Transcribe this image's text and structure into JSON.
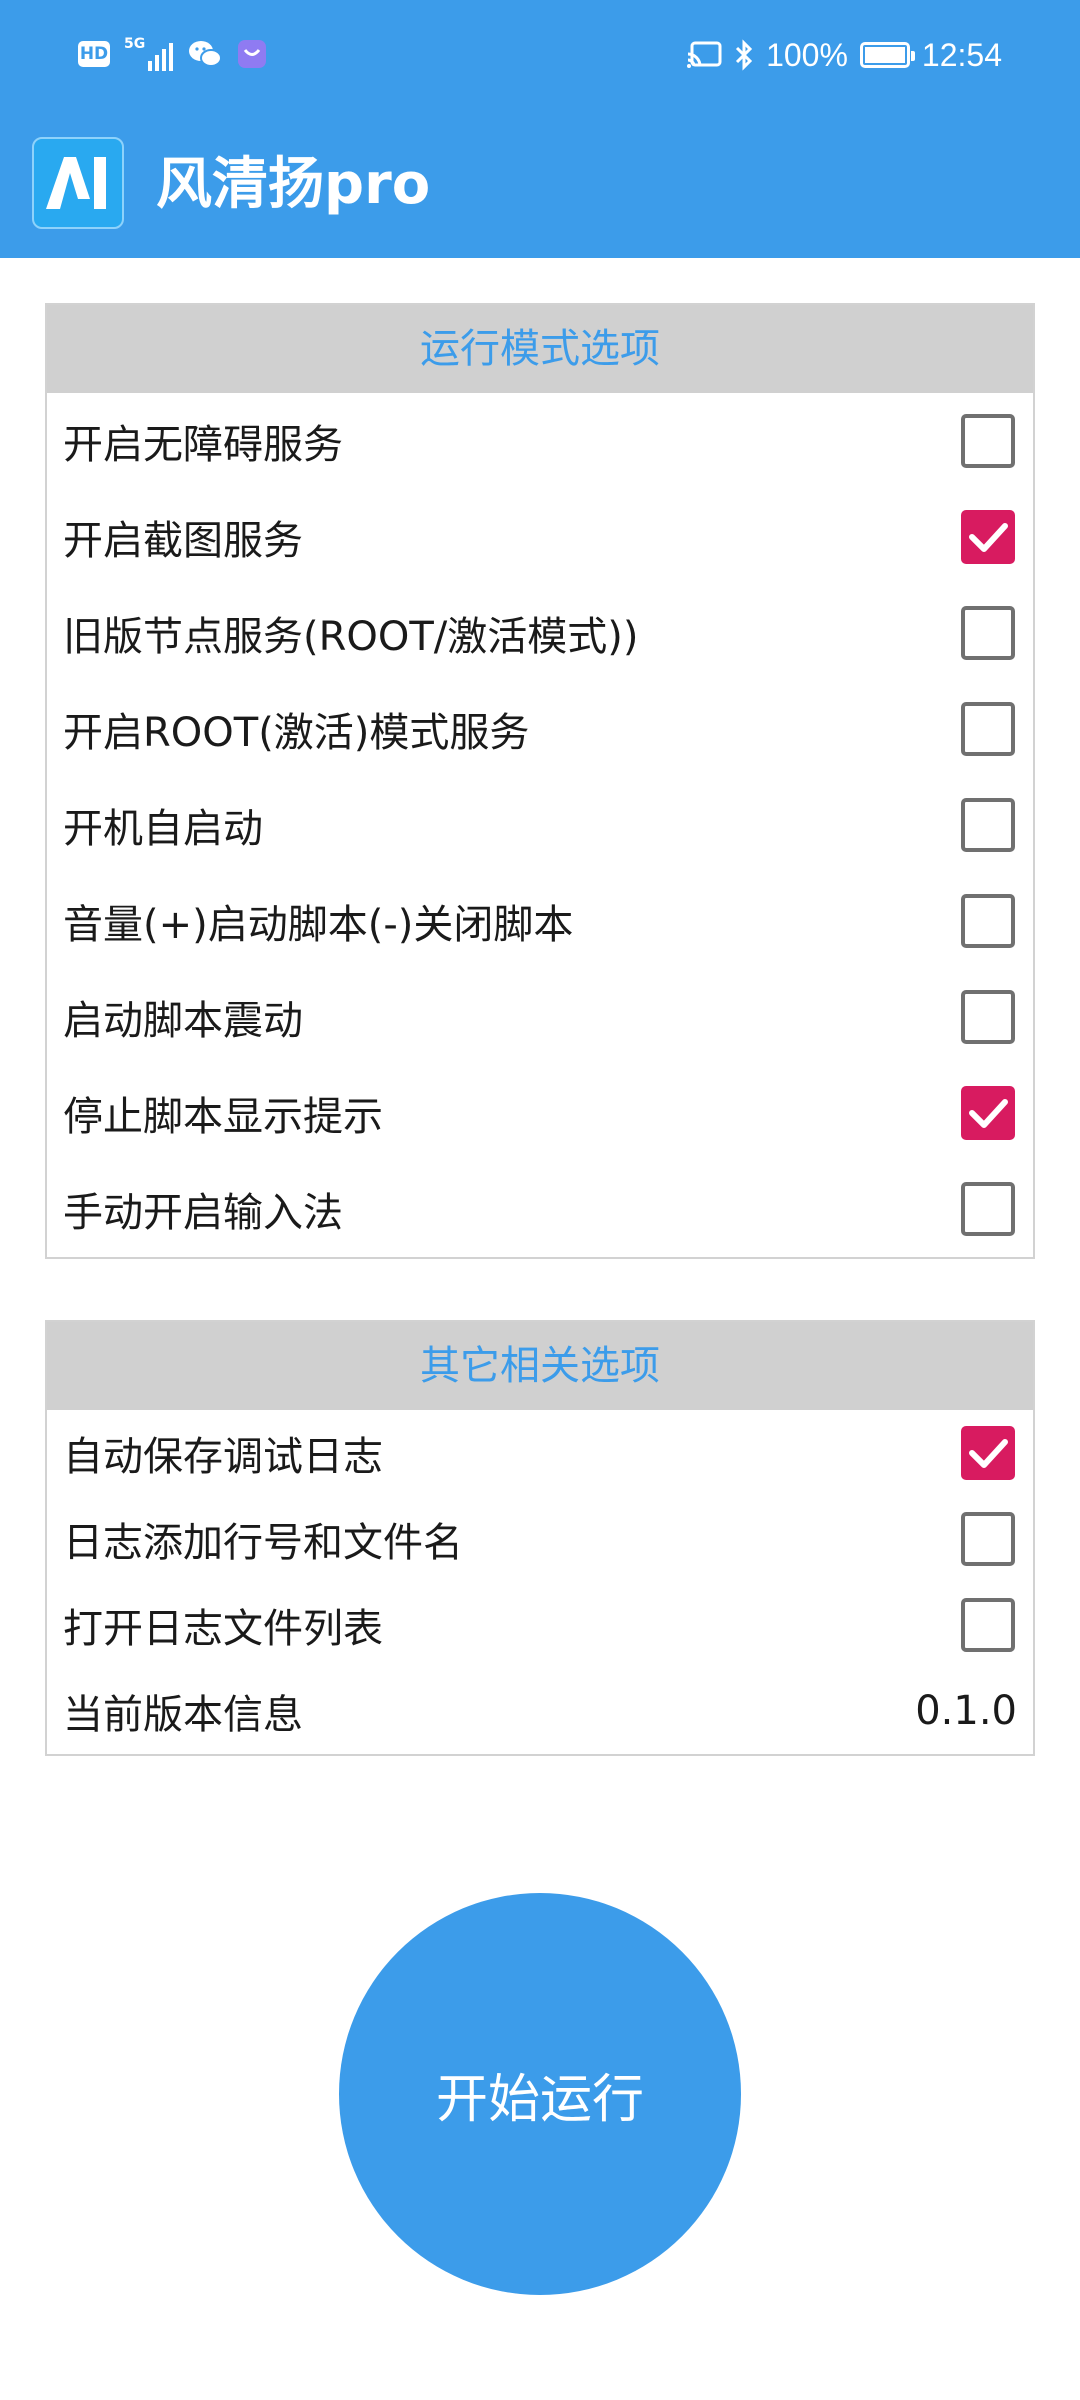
{
  "status_bar": {
    "hd_label": "HD",
    "network": "5G",
    "battery": "100%",
    "time": "12:54",
    "icons": [
      "signal-icon",
      "wechat-icon",
      "app-icon",
      "cast-icon",
      "bluetooth-icon",
      "battery-icon"
    ]
  },
  "app_bar": {
    "logo_text": "AI",
    "title": "风清扬pro"
  },
  "run_mode_section": {
    "header": "运行模式选项",
    "items": [
      {
        "label": "开启无障碍服务",
        "checked": false
      },
      {
        "label": "开启截图服务",
        "checked": true
      },
      {
        "label": "旧版节点服务(ROOT/激活模式))",
        "checked": false
      },
      {
        "label": "开启ROOT(激活)模式服务",
        "checked": false
      },
      {
        "label": "开机自启动",
        "checked": false
      },
      {
        "label": "音量(+)启动脚本(-)关闭脚本",
        "checked": false
      },
      {
        "label": "启动脚本震动",
        "checked": false
      },
      {
        "label": "停止脚本显示提示",
        "checked": true
      },
      {
        "label": "手动开启输入法",
        "checked": false
      }
    ]
  },
  "other_section": {
    "header": "其它相关选项",
    "items": [
      {
        "label": "自动保存调试日志",
        "checked": true
      },
      {
        "label": "日志添加行号和文件名",
        "checked": false
      },
      {
        "label": "打开日志文件列表",
        "checked": false
      }
    ],
    "version_label": "当前版本信息",
    "version_value": "0.1.0"
  },
  "start_button": {
    "label": "开始运行"
  },
  "colors": {
    "primary": "#3c9cea",
    "checked": "#d81b60",
    "header_bg": "#d0d0d0",
    "unchecked_border": "#707070"
  }
}
